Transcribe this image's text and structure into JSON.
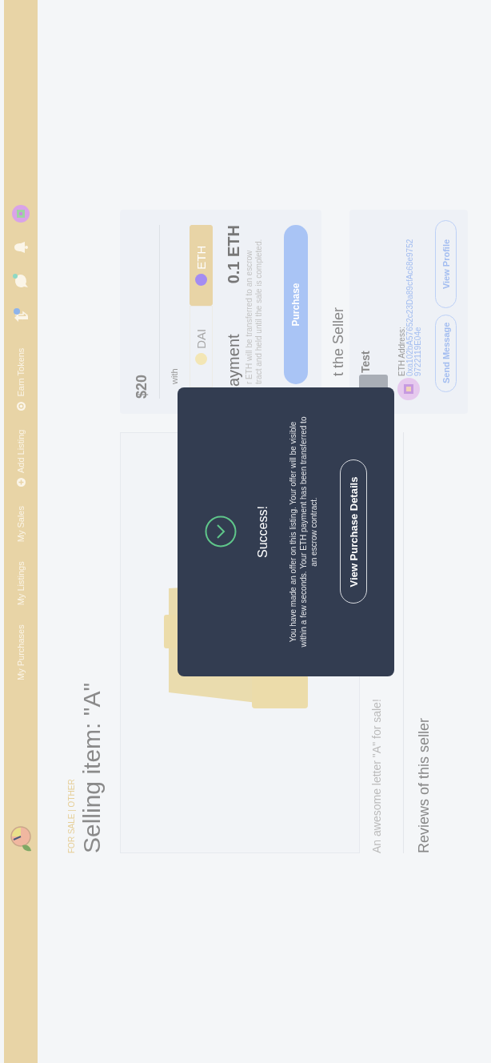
{
  "navbar": {
    "links": [
      {
        "label": "My Purchases",
        "kind": "link"
      },
      {
        "label": "My Listings",
        "kind": "link"
      },
      {
        "label": "My Sales",
        "kind": "link"
      },
      {
        "label": "Add Listing",
        "kind": "add"
      },
      {
        "label": "Earn Tokens",
        "kind": "earn"
      }
    ]
  },
  "listing": {
    "category": "FOR SALE | OTHER",
    "title": "Selling item: \"A\"",
    "description": "An awesome letter \"A\" for sale!",
    "reviews_heading": "Reviews of this seller"
  },
  "purchase": {
    "price": "$20",
    "pay_with_label": "with",
    "currencies": [
      {
        "label": "DAI",
        "selected": false,
        "color": "#f3e6b5"
      },
      {
        "label": "ETH",
        "selected": true,
        "color": "#a48cf2"
      }
    ],
    "payment_heading": "ayment",
    "amount": "0.1 ETH",
    "note_lines": [
      "r ETH will be transferred to an escrow",
      "tract and held until the sale is completed."
    ],
    "button": "Purchase"
  },
  "seller": {
    "heading": "t the Seller",
    "name": "Test",
    "address_label": "ETH Address:",
    "address_lines": [
      "0xa102bA57652c23Da89cfAc68e9752",
      "9722119E04e"
    ],
    "buttons": [
      "Send Message",
      "View Profile"
    ]
  },
  "modal": {
    "title": "Success!",
    "message": "You have made an offer on this listing. Your offer will be visible within a few seconds. Your ETH payment has been transferred to an escrow contract.",
    "button": "View Purchase Details"
  }
}
